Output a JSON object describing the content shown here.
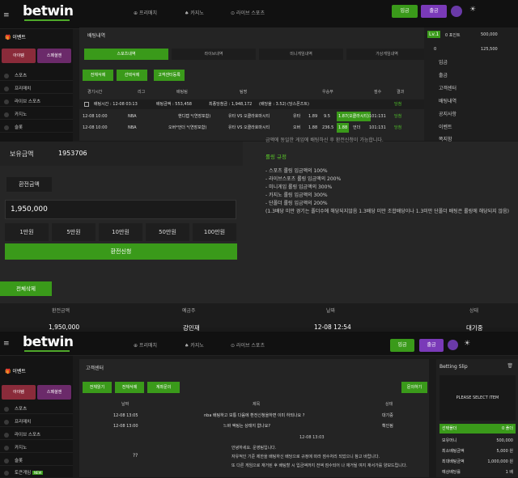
{
  "header": {
    "logo": "betwin",
    "nav": [
      "프리매치",
      "카지노",
      "라이브 스포츠"
    ],
    "deposit": "입금",
    "withdraw": "출금"
  },
  "sidebar": {
    "items": [
      "스포츠",
      "프리매치",
      "라이브 스포츠",
      "카지노",
      "슬롯",
      "토큰게임"
    ],
    "new_badge": "NEW",
    "tiles": [
      "아이템",
      "스페셜엔"
    ]
  },
  "betting_history": {
    "title": "배팅내역",
    "tabs": [
      "스포츠내역",
      "라이브내역",
      "미니게임내역",
      "가상게임내역"
    ],
    "buttons": [
      "전체삭제",
      "선택삭제",
      "고객센터등록"
    ],
    "columns": [
      "경기시간",
      "리그",
      "배팅팀",
      "팀명",
      "우승부",
      "점수",
      "결과"
    ],
    "summary": [
      "배팅시간 : 12-08 03:13",
      "배팅금액 : 553,458",
      "최종당첨금 : 1,948,172",
      "(배당율 : 3.52)",
      "(당스폰즈트)",
      "당첨"
    ],
    "rows": [
      {
        "time": "12-08 10:00",
        "league": "NBA",
        "pick": "핸디캡 *(연장포함)",
        "match": "유타 VS 오클라호마시티",
        "side": "유타",
        "o1": "1.89",
        "line": "9.5",
        "o2": "1.87(오클라시티)",
        "score": "101:131",
        "result": "당첨"
      },
      {
        "time": "12-08 10:00",
        "league": "NBA",
        "pick": "오버*언더 *(연장포함)",
        "match": "유타 VS 오클라호마시티",
        "side": "오버",
        "o1": "1.88",
        "line": "236.5",
        "o2": "1.88",
        "o3": "언더",
        "score": "101:131",
        "result": "당첨"
      }
    ]
  },
  "right_panel": {
    "level": "Lv.1",
    "rows": [
      [
        "0 포인트",
        "500,000"
      ],
      [
        "0",
        "125,500"
      ]
    ],
    "menu": [
      "입금",
      "출금",
      "고객센터",
      "배팅내역",
      "공지사항",
      "이벤트",
      "쪽지함"
    ]
  },
  "exchange": {
    "balance_label": "보유금액",
    "balance_value": "1953706",
    "apply_label": "환전금액",
    "input_value": "1,950,000",
    "amounts": [
      "1만원",
      "5만원",
      "10만원",
      "50만원",
      "100만원"
    ],
    "apply_button": "환전신청",
    "rules_title": "롤링 규정",
    "rules_top": "금액에 동일한 게임에 배팅하신 후 환전신청이 가능합니다.",
    "rules": [
      "- 스포츠 롤링 입금액의 100%",
      "- 라이브스포츠 롤링 입금액의 200%",
      "- 미니게임 롤링 입금액의 300%",
      "- 카지노 롤링 입금액의 300%",
      "- 단폴더 롤링 입금액의 200%",
      "(1.3배당 미만 경기는 폴더수에 해당되지않음 1.3배당 미만 조합배당이나 1.3미만 단폴더 배팅은 롤링에 해당되지 않음)"
    ],
    "delete_all": "전체삭제",
    "table_headers": [
      "환전금액",
      "예금주",
      "날짜",
      "상태"
    ],
    "table_row": [
      "1,950,000",
      "강민재",
      "12-08 12:54",
      "대기중"
    ]
  },
  "support": {
    "title": "고객센터",
    "buttons": [
      "전체읽기",
      "전체삭제",
      "계좌문의"
    ],
    "write": "문의하기",
    "columns": [
      "날짜",
      "제목",
      "상태"
    ],
    "rows": [
      {
        "date": "12-08 13:05",
        "title": "nba 배팅하고 보통 다음에 환전신청을하면 이미 하되나요 ?",
        "status": "대기중"
      },
      {
        "date": "12-08 13:00",
        "title": "느바 액팅는 상태지 없나요?",
        "status": "확인됨"
      }
    ],
    "reply_date": "12-08 13:03",
    "reply_lines": [
      "안녕하세요. 운영팀입니다.",
      "자유적인 기준 제한을 배팅하신 배당으로 규정에 따라 점수처리 되었으니 참고 바랍니다.",
      "또 다른 게임으로 재거된 후 배팅할 시 입금액까지 전액 점수되어 나 재거될 여지 재서가를 양보드립니다."
    ],
    "qmark": "??"
  },
  "bet_slip": {
    "title": "Betting Slip",
    "empty": "PLEASE SELECT ITEM",
    "rows": [
      [
        "선택폴더",
        "0 폴더"
      ],
      [
        "보유머니",
        "500,000"
      ],
      [
        "최소배팅금액",
        "5,000 원"
      ],
      [
        "최대배팅금액",
        "1,000,000 원"
      ],
      [
        "예상배당률",
        "1 배"
      ]
    ]
  }
}
